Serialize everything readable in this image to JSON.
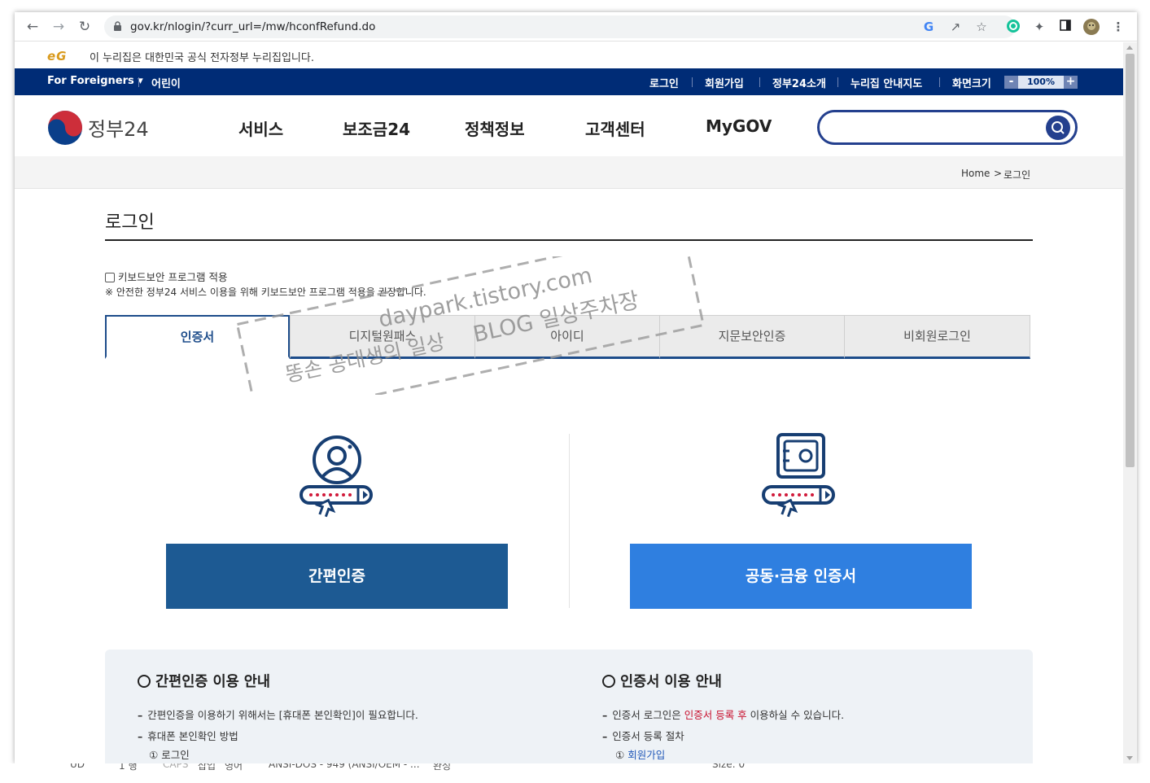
{
  "browser": {
    "url": "gov.kr/nlogin/?curr_url=/mw/hconfRefund.do"
  },
  "notice": {
    "logo_text": "eG",
    "text": "이 누리집은 대한민국 공식 전자정부 누리집입니다."
  },
  "utility": {
    "foreigners": "For Foreigners ▾",
    "kids": "어린이",
    "login": "로그인",
    "signup": "회원가입",
    "about": "정부24소개",
    "sitemap": "누리집 안내지도",
    "screen_size": "화면크기",
    "zoom_minus": "-",
    "zoom_value": "100%",
    "zoom_plus": "+"
  },
  "header": {
    "logo_text": "정부24",
    "nav": [
      "서비스",
      "보조금24",
      "정책정보",
      "고객센터",
      "MyGOV"
    ],
    "search_placeholder": ""
  },
  "breadcrumb": {
    "home": "Home",
    "sep": ">",
    "current": "로그인"
  },
  "page": {
    "title": "로그인",
    "keyboard_security_label": "키보드보안 프로그램 적용",
    "keyboard_note": "※ 안전한 정부24 서비스 이용을 위해 키보드보안 프로그램 적용을 권장합니다."
  },
  "tabs": [
    {
      "label": "인증서",
      "active": true
    },
    {
      "label": "디지털원패스",
      "active": false
    },
    {
      "label": "아이디",
      "active": false
    },
    {
      "label": "지문보안인증",
      "active": false
    },
    {
      "label": "비회원로그인",
      "active": false
    }
  ],
  "options": {
    "simple_auth": {
      "label": "간편인증",
      "color": "#1d5a93",
      "icon": "user-password-icon"
    },
    "cert_auth": {
      "label": "공동·금융 인증서",
      "color": "#2f7fe0",
      "icon": "safe-password-icon"
    }
  },
  "guide": {
    "left": {
      "title": "간편인증 이용 안내",
      "line1": "간편인증을 이용하기 위해서는 [휴대폰 본인확인]이 필요합니다.",
      "line2": "휴대폰 본인확인 방법",
      "step1_num": "①",
      "step1": "로그인"
    },
    "right": {
      "title": "인증서 이용 안내",
      "line1_a": "인증서 로그인은",
      "line1_b": "인증서 등록 후",
      "line1_c": "이용하실 수 있습니다.",
      "line2": "인증서 등록 절차",
      "step1_num": "①",
      "step1": "회원가입"
    }
  },
  "watermark": {
    "line1": "daypark.tistory.com",
    "line2": "BLOG 일상주차장",
    "line3": "똥손 공대생의 일상"
  },
  "taskbar": {
    "items": [
      "UD",
      "1 행",
      "CAPS",
      "삽입",
      "영어",
      "ANSI-DOS - 949 (ANSI/OEM - ...",
      "완성",
      "Size: 0"
    ]
  }
}
